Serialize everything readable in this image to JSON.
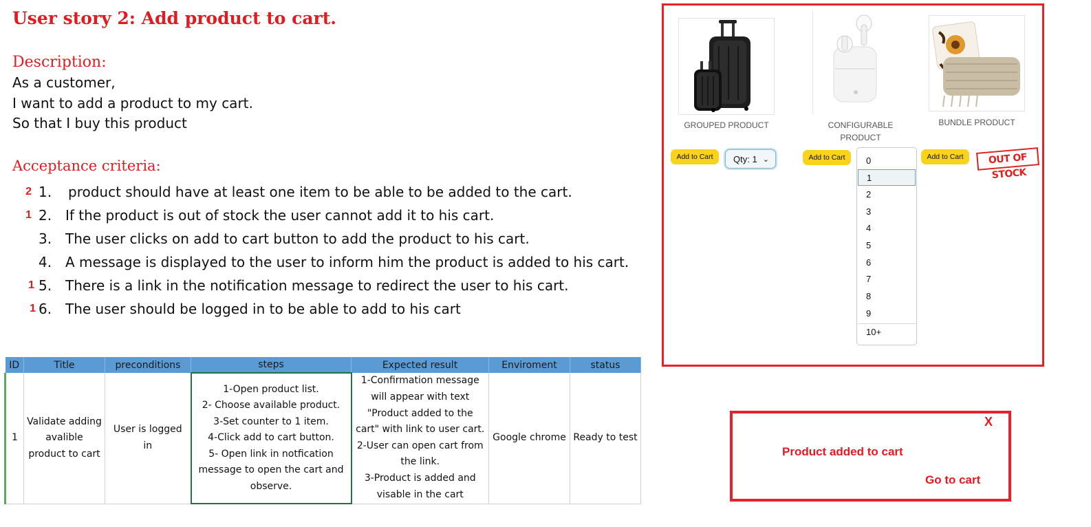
{
  "story": {
    "title": "User story 2: Add product to cart.",
    "description_heading": "Description:",
    "description_lines": [
      "As a customer,",
      "I want to add a product to my cart.",
      "So that I buy this product"
    ],
    "criteria_heading": "Acceptance criteria:",
    "criteria": [
      {
        "mark": "2",
        "num": "1.",
        "text": "product should have at least one item to be able to be added to the cart."
      },
      {
        "mark": "1",
        "num": "2.",
        "text": "If the product is out of stock the user cannot add it to his cart."
      },
      {
        "mark": "",
        "num": "3.",
        "text": "The user clicks on add to cart button to add the product to his cart."
      },
      {
        "mark": "",
        "num": "4.",
        "text": "A message is displayed to the user to inform him the product is added to his cart."
      },
      {
        "mark": "1",
        "num": "5.",
        "text": "There is a link in the notification message to redirect the user to his cart."
      },
      {
        "mark": "1",
        "num": "6.",
        "text": "The user should be logged in to be able to add to his cart"
      }
    ]
  },
  "test_table": {
    "headers": [
      "ID",
      "Title",
      "preconditions",
      "steps",
      "Expected result",
      "Enviroment",
      "status"
    ],
    "row": {
      "id": "1",
      "title_lines": [
        "Validate adding",
        "avalible",
        "product to cart"
      ],
      "preconditions": "User is logged in",
      "steps_lines": [
        "1-Open product list.",
        "2- Choose available product.",
        "3-Set counter to 1 item.",
        "4-Click add to cart button.",
        "5- Open link in notfication",
        "message to open the cart and",
        "observe."
      ],
      "expected_lines": [
        "1-Confirmation message",
        "will appear with text",
        "\"Product added to the",
        "cart\" with link to user cart.",
        "2-User can open cart from",
        "the link.",
        "3-Product is added and",
        "visable in the cart"
      ],
      "environment": "Google chrome",
      "status": "Ready to test"
    }
  },
  "products": {
    "items": [
      {
        "label_lines": [
          "GROUPED PRODUCT"
        ],
        "button": "Add to Cart",
        "icon": "luggage-icon"
      },
      {
        "label_lines": [
          "CONFIGURABLE",
          "PRODUCT"
        ],
        "button": "Add to Cart",
        "icon": "earbuds-icon"
      },
      {
        "label_lines": [
          "BUNDLE PRODUCT"
        ],
        "button": "Add to Cart",
        "icon": "pillow-blanket-icon"
      }
    ],
    "qty_label": "Qty: 1",
    "qty_options": [
      "0",
      "1",
      "2",
      "3",
      "4",
      "5",
      "6",
      "7",
      "8",
      "9",
      "10+"
    ],
    "selected_option": "1",
    "out_of_stock": "OUT OF STOCK",
    "accent_color": "#f8d21b",
    "border_color": "#e5212b"
  },
  "notification": {
    "close": "X",
    "message": "Product added to cart",
    "link": "Go to cart"
  }
}
